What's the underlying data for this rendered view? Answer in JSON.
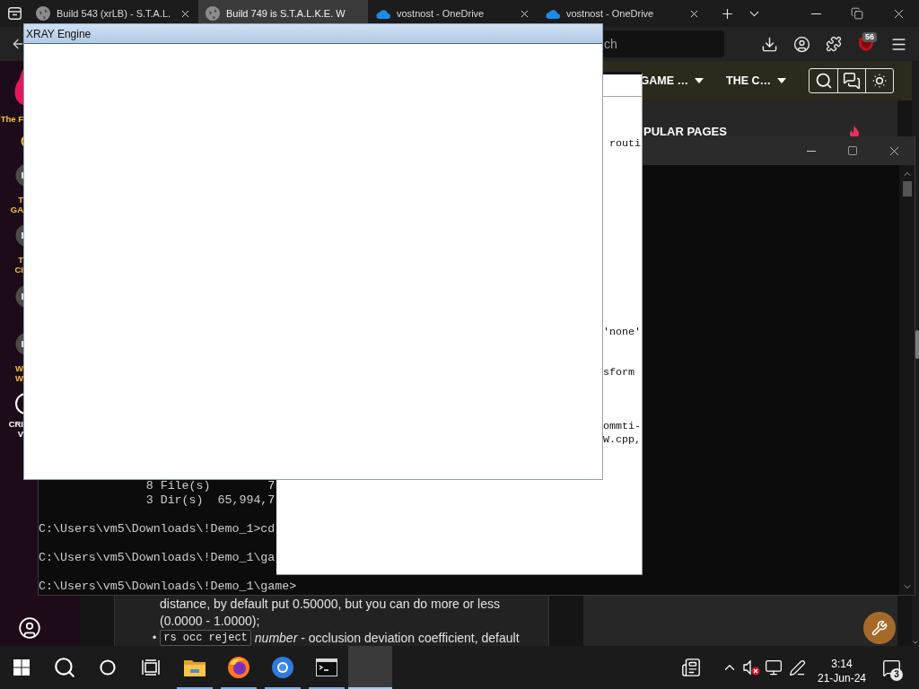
{
  "browser": {
    "tabs": [
      {
        "kind": "disc",
        "title": "Build 543 (xrLB) - S.T.A.L.",
        "selected": false,
        "closable": true
      },
      {
        "kind": "disc",
        "title": "Build 749 is S.T.A.L.K.E. W",
        "selected": true,
        "closable": false
      },
      {
        "kind": "cloud",
        "title": "vostnost - OneDrive",
        "selected": false,
        "closable": true
      },
      {
        "kind": "cloud",
        "title": "vostnost - OneDrive",
        "selected": false,
        "closable": true
      }
    ],
    "address_bar": {
      "placeholder": "ch"
    },
    "extension_badge": "56"
  },
  "website": {
    "sidebar": [
      {
        "kind": "logo",
        "lines": [
          "The F"
        ]
      },
      {
        "kind": "coin"
      },
      {
        "kind": "disc",
        "lines": [
          "T",
          "GA"
        ]
      },
      {
        "kind": "disc",
        "lines": [
          "T",
          "CI"
        ]
      },
      {
        "kind": "disc"
      },
      {
        "kind": "disc",
        "lines": [
          "W",
          "W"
        ]
      },
      {
        "kind": "ring",
        "lines": [
          "CRI",
          "V"
        ]
      }
    ],
    "nav": [
      {
        "label": "GAME …"
      },
      {
        "label": "THE C…"
      }
    ],
    "popular_heading": "PULAR PAGES",
    "article": {
      "paragraph": "distance, by default put 0.50000, but you can do more or less (0.0000 - 1.0000);",
      "bullet": "•",
      "code": "rs occ reject",
      "text": "*number* - occlusion deviation coefficient, default"
    }
  },
  "console": {
    "lines": [
      {
        "kind": "output",
        "text": "8 File(s)        7"
      },
      {
        "kind": "output",
        "text": "3 Dir(s)  65,994,7"
      },
      {
        "kind": "prompt",
        "text": "C:\\Users\\vm5\\Downloads\\!Demo_1>cd"
      },
      {
        "kind": "prompt",
        "text": "C:\\Users\\vm5\\Downloads\\!Demo_1\\ga"
      },
      {
        "kind": "prompt",
        "text": "C:\\Users\\vm5\\Downloads\\!Demo_1\\game>"
      }
    ]
  },
  "text_window": {
    "lines": [
      "routi",
      "'none'",
      "sform",
      "ommti-",
      "W.cpp,"
    ]
  },
  "xray_window": {
    "title": "XRAY Engine"
  },
  "taskbar": {
    "buttons": [
      {
        "kind": "start"
      },
      {
        "kind": "search"
      },
      {
        "kind": "cortana"
      },
      {
        "kind": "taskview"
      }
    ],
    "apps": [
      {
        "kind": "folder",
        "running": true,
        "selected": false
      },
      {
        "kind": "firefox",
        "running": true,
        "selected": false
      },
      {
        "kind": "chromium",
        "running": true,
        "selected": false
      },
      {
        "kind": "terminal",
        "running": true,
        "selected": false
      },
      {
        "kind": "blank",
        "running": true,
        "selected": true
      }
    ],
    "tray": {
      "icons": [
        {
          "kind": "news"
        },
        {
          "kind": "chevron"
        },
        {
          "kind": "speaker"
        },
        {
          "kind": "network"
        },
        {
          "kind": "pen"
        }
      ],
      "sound_muted": true,
      "time": "3:14",
      "date": "21-Jun-24",
      "notifications": "3"
    }
  }
}
